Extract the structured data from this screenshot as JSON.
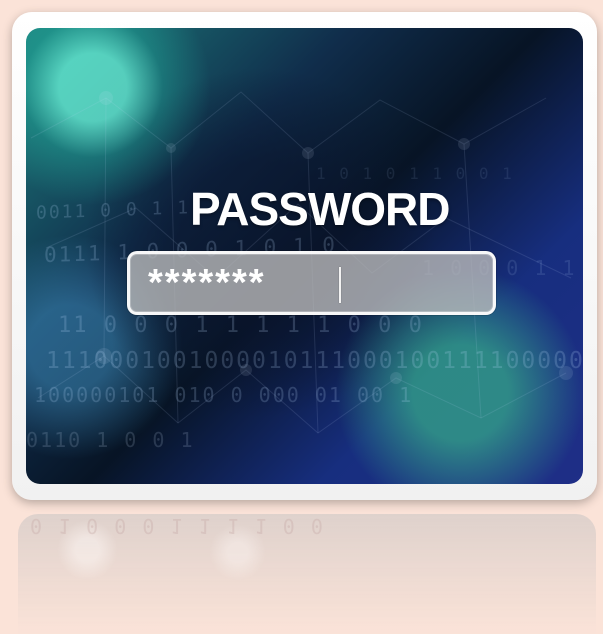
{
  "title": "PASSWORD",
  "password_field": {
    "masked_value": "*******"
  },
  "decorative": {
    "binary_rows": [
      "0011   0 0 1 1",
      "0111  1 0 0 0   1 0 1 0",
      "11 0 0 0 1 1 1 1 1 0 0 0",
      "1110001001000010111000100111100000",
      "100000101 010 0 000 01 00 1",
      "0110  1 0 0 1",
      "1 0 1 0 1 1 0 0 1",
      "1 0 0 0 1 1"
    ],
    "reflection_text": "0 1 0 0 0 1 1  1 1 0 0"
  }
}
